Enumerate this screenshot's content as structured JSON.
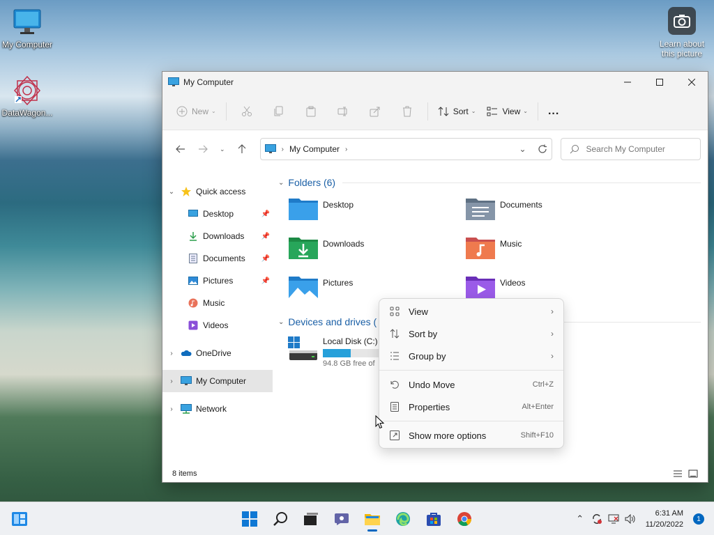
{
  "desktop": {
    "icons": [
      {
        "label": "My Computer"
      },
      {
        "label": "DataWagon..."
      }
    ],
    "learn_about": "Learn about this picture"
  },
  "window": {
    "title": "My Computer",
    "toolbar": {
      "new_label": "New",
      "sort_label": "Sort",
      "view_label": "View",
      "more_label": "..."
    },
    "address": {
      "breadcrumb": "My Computer"
    },
    "search": {
      "placeholder": "Search My Computer"
    },
    "sidebar": {
      "quick_access": "Quick access",
      "pinned": [
        {
          "label": "Desktop",
          "icon": "desktop-icon",
          "pinned": true
        },
        {
          "label": "Downloads",
          "icon": "download-icon",
          "pinned": true
        },
        {
          "label": "Documents",
          "icon": "document-icon",
          "pinned": true
        },
        {
          "label": "Pictures",
          "icon": "pictures-icon",
          "pinned": true
        },
        {
          "label": "Music",
          "icon": "music-icon",
          "pinned": false
        },
        {
          "label": "Videos",
          "icon": "videos-icon",
          "pinned": false
        }
      ],
      "onedrive": "OneDrive",
      "my_computer": "My Computer",
      "network": "Network"
    },
    "content": {
      "folders_header": "Folders (6)",
      "folders": [
        {
          "name": "Desktop",
          "icon": "desktop-folder-icon"
        },
        {
          "name": "Documents",
          "icon": "documents-folder-icon"
        },
        {
          "name": "Downloads",
          "icon": "downloads-folder-icon"
        },
        {
          "name": "Music",
          "icon": "music-folder-icon"
        },
        {
          "name": "Pictures",
          "icon": "pictures-folder-icon"
        },
        {
          "name": "Videos",
          "icon": "videos-folder-icon"
        }
      ],
      "devices_header": "Devices and drives (",
      "drive": {
        "name": "Local Disk (C:)",
        "free_text": "94.8 GB free of",
        "used_fraction": 0.5
      }
    },
    "status": {
      "items": "8 items"
    }
  },
  "context_menu": {
    "items": [
      {
        "label": "View",
        "icon": "view-grid-icon",
        "submenu": true
      },
      {
        "label": "Sort by",
        "icon": "sort-icon",
        "submenu": true
      },
      {
        "label": "Group by",
        "icon": "group-icon",
        "submenu": true
      },
      {
        "label": "Undo Move",
        "icon": "undo-icon",
        "shortcut": "Ctrl+Z"
      },
      {
        "label": "Properties",
        "icon": "properties-icon",
        "shortcut": "Alt+Enter"
      },
      {
        "label": "Show more options",
        "icon": "more-options-icon",
        "shortcut": "Shift+F10"
      }
    ]
  },
  "taskbar": {
    "time": "6:31 AM",
    "date": "11/20/2022",
    "notification_count": "1"
  },
  "colors": {
    "accent": "#0067c0",
    "folder_blue": "#2f8fd8",
    "drive_bar": "#26a0da"
  }
}
